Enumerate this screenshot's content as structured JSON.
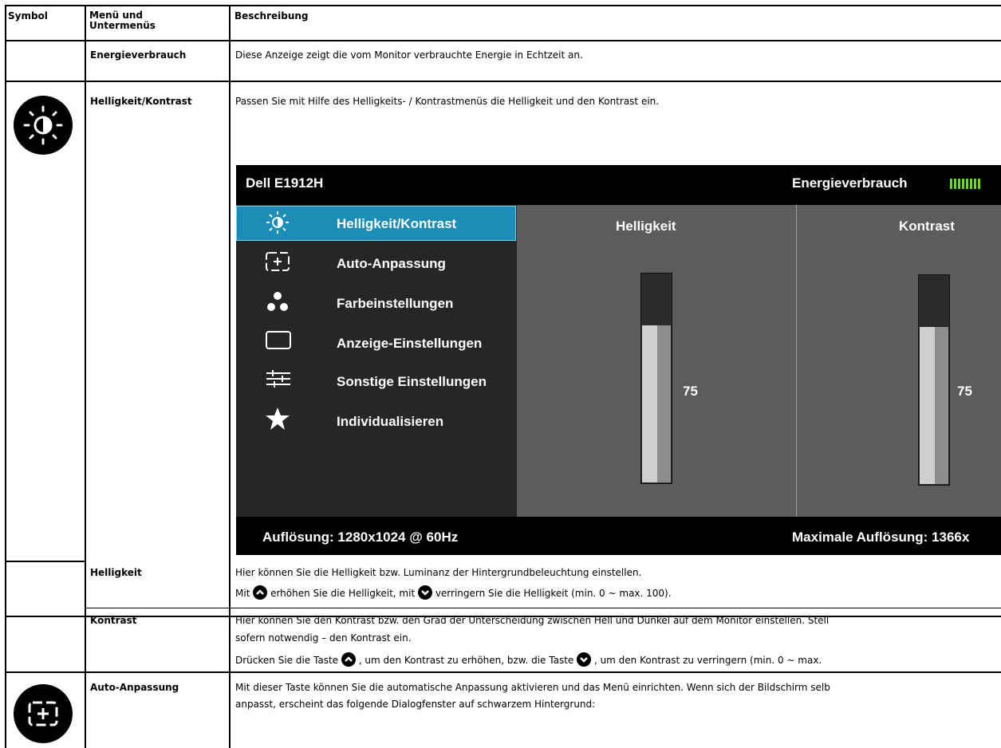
{
  "headers": {
    "symbol": "Symbol",
    "menu": "Menü und Untermenüs",
    "description": "Beschreibung"
  },
  "rows": {
    "energy": {
      "menu": "Energieverbrauch",
      "desc": "Diese Anzeige zeigt die vom Monitor verbrauchte Energie in Echtzeit an."
    },
    "brightness_contrast": {
      "menu": "Helligkeit/Kontrast",
      "desc": "Passen Sie mit Hilfe des Helligkeits- / Kontrastmenüs die Helligkeit und den Kontrast ein."
    },
    "brightness": {
      "menu": "Helligkeit",
      "desc": "Hier können Sie die Helligkeit bzw. Luminanz der Hintergrundbeleuchtung einstellen.",
      "desc2_a": "Mit",
      "desc2_b": "erhöhen Sie die Helligkeit, mit",
      "desc2_c": "verringern Sie die Helligkeit (min. 0 ~ max. 100)."
    },
    "contrast": {
      "menu": "Kontrast",
      "desc": "Hier können Sie den Kontrast bzw. den Grad der Unterscheidung zwischen Hell und Dunkel auf dem Monitor einstellen. Stell",
      "desc_cont": "sofern notwendig – den Kontrast ein.",
      "desc2_a": "Drücken Sie die Taste",
      "desc2_b": ", um den Kontrast zu erhöhen, bzw. die Taste",
      "desc2_c": ", um den Kontrast zu verringern (min. 0 ~ max."
    },
    "auto_adjust": {
      "menu": "Auto-Anpassung",
      "desc": "Mit dieser Taste können Sie die automatische Anpassung aktivieren und das Menü einrichten. Wenn sich der Bildschirm selb",
      "desc_cont": "anpasst, erscheint das folgende Dialogfenster auf schwarzem Hintergrund:"
    }
  },
  "osd": {
    "model": "Dell E1912H",
    "energy_label": "Energieverbrauch",
    "menu_items": [
      {
        "label": "Helligkeit/Kontrast",
        "icon": "brightness-icon",
        "selected": true
      },
      {
        "label": "Auto-Anpassung",
        "icon": "auto-adjust-icon"
      },
      {
        "label": "Farbeinstellungen",
        "icon": "color-dots-icon"
      },
      {
        "label": "Anzeige-Einstellungen",
        "icon": "display-rect-icon"
      },
      {
        "label": "Sonstige Einstellungen",
        "icon": "sliders-icon"
      },
      {
        "label": "Individualisieren",
        "icon": "star-icon"
      }
    ],
    "brightness_label": "Helligkeit",
    "contrast_label": "Kontrast",
    "brightness_value": "75",
    "contrast_value": "75",
    "brightness_level": 75,
    "contrast_level": 75,
    "resolution": "Auflösung: 1280x1024 @ 60Hz",
    "max_resolution": "Maximale Auflösung: 1366x"
  },
  "colors": {
    "osd_selected": "#1b8db6",
    "energy_green": "#6cd92a"
  }
}
